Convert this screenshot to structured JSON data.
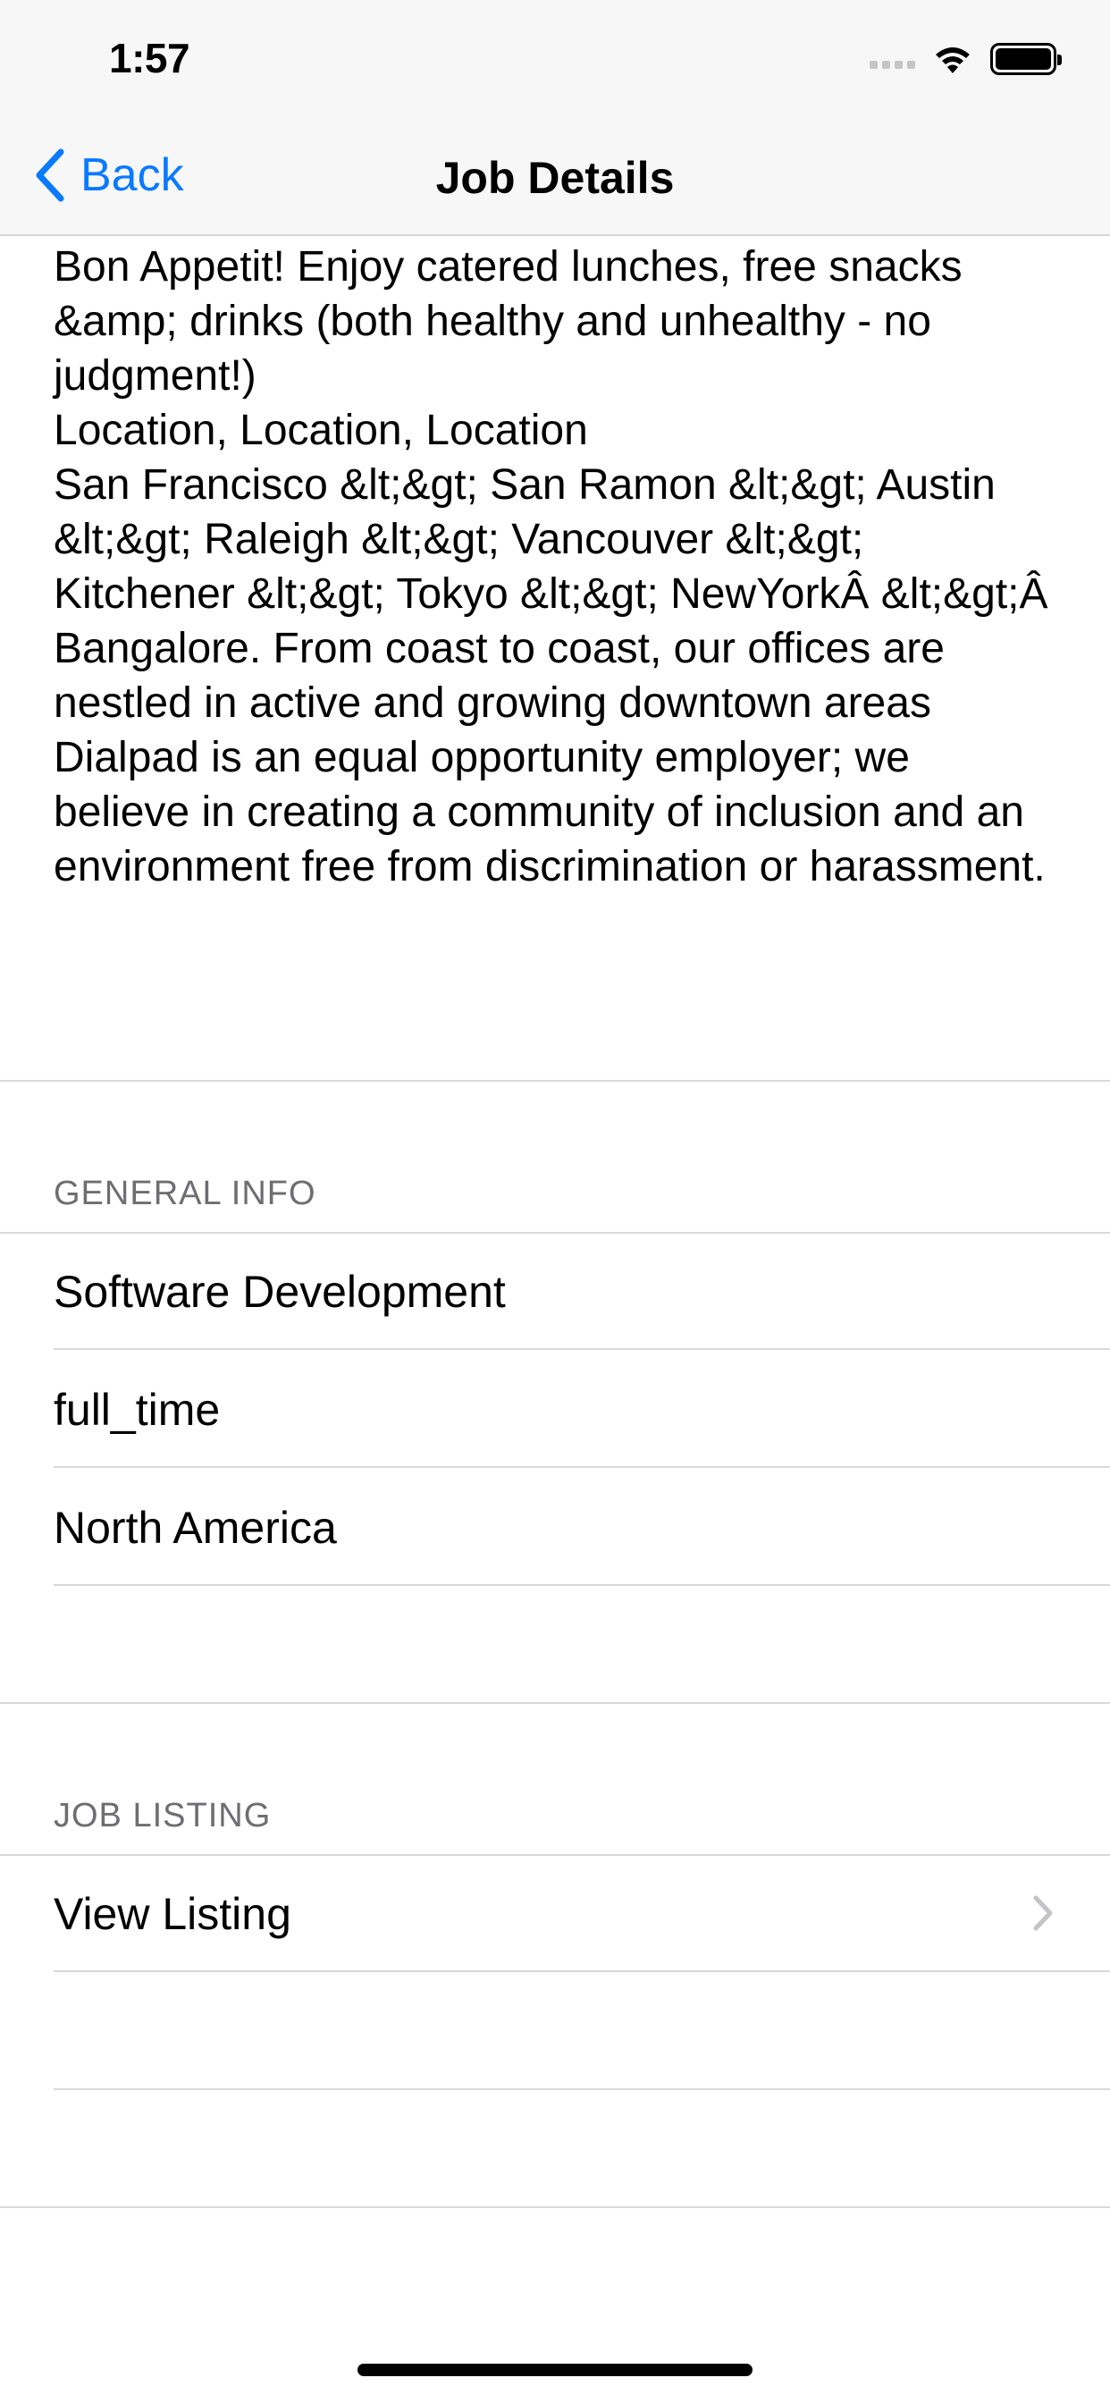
{
  "status_bar": {
    "time": "1:57"
  },
  "nav": {
    "back_label": "Back",
    "title": "Job Details"
  },
  "description": "Bon Appetit! Enjoy catered lunches, free snacks &amp; drinks (both healthy and unhealthy - no judgment!)\nLocation, Location, Location\nSan Francisco &lt;&gt; San Ramon &lt;&gt; Austin &lt;&gt; Raleigh &lt;&gt; Vancouver &lt;&gt; Kitchener &lt;&gt; Tokyo &lt;&gt; NewYorkÂ &lt;&gt;Â Bangalore. From coast to coast, our offices are nestled in active and growing downtown areas\nDialpad is an equal opportunity employer; we believe in creating a community of inclusion and an environment free from discrimination or harassment.",
  "general_info": {
    "header": "GENERAL INFO",
    "rows": [
      "Software Development",
      "full_time",
      "North America"
    ]
  },
  "job_listing": {
    "header": "JOB LISTING",
    "view_label": "View Listing"
  },
  "icons": {
    "back": "chevron-left-icon",
    "disclosure": "chevron-right-icon",
    "wifi": "wifi-icon",
    "battery": "battery-icon",
    "signal": "cellular-signal-icon"
  },
  "colors": {
    "accent": "#0a7aff",
    "section_header": "#6d6d72",
    "separator": "#d9d9db"
  }
}
